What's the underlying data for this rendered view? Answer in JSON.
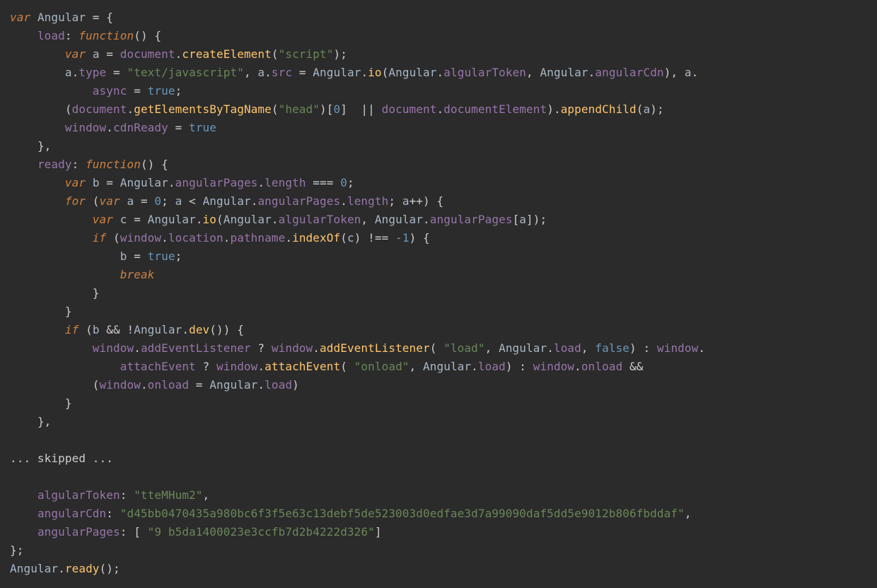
{
  "code": {
    "line1": {
      "kw_var": "var",
      "Angular": "Angular",
      "eq": " = {"
    },
    "line2": {
      "prop_load": "load",
      "colon": ": ",
      "kw_fn": "function",
      "paren": "() {"
    },
    "line3": {
      "kw_var": "var",
      "a": "a",
      "eq": " = ",
      "doc": "document",
      "dot": ".",
      "call": "createElement",
      "arg": "\"script\"",
      "end": ");"
    },
    "line4": {
      "a1": "a",
      "dot1": ".",
      "type": "type",
      "eq1": " = ",
      "str1": "\"text/javascript\"",
      "comma": ", ",
      "a2": "a",
      "dot2": ".",
      "src": "src",
      "eq2": " = ",
      "Ang": "Angular",
      "dot3": ".",
      "io": "io",
      "lp": "(",
      "Ang2": "Angular",
      "dot4": ".",
      "tok": "algularToken",
      "comma2": ", ",
      "Ang3": "Angular",
      "dot5": ".",
      "cdn": "angularCdn",
      "rp": "), ",
      "a3": "a",
      "dot6": "."
    },
    "line5": {
      "async": "async",
      "eq": " = ",
      "true": "true",
      "semi": ";"
    },
    "line6": {
      "lp": "(",
      "doc": "document",
      "dot": ".",
      "get": "getElementsByTagName",
      "arg": "\"head\"",
      "idx": ")[",
      "zero": "0",
      "rb": "] ",
      "or": " || ",
      "doc2": "document",
      "dot2": ".",
      "docel": "documentElement",
      "rp": ").",
      "append": "appendChild",
      "lp2": "(",
      "a": "a",
      "end": ");"
    },
    "line7": {
      "win": "window",
      "dot": ".",
      "cdn": "cdnReady",
      "eq": " = ",
      "true": "true"
    },
    "line8": {
      "brace": "},"
    },
    "line9": {
      "prop_ready": "ready",
      "colon": ": ",
      "kw_fn": "function",
      "paren": "() {"
    },
    "line10": {
      "kw_var": "var",
      "b": "b",
      "eq": " = ",
      "Ang": "Angular",
      "dot": ".",
      "pages": "angularPages",
      "dot2": ".",
      "len": "length",
      "eqeq": " === ",
      "zero": "0",
      "semi": ";"
    },
    "line11": {
      "kw_for": "for",
      "lp": " (",
      "kw_var": "var",
      "a": "a",
      "eq": " = ",
      "zero": "0",
      "semi": "; ",
      "a2": "a",
      "lt": " < ",
      "Ang": "Angular",
      "dot": ".",
      "pages": "angularPages",
      "dot2": ".",
      "len": "length",
      "semi2": "; ",
      "a3": "a",
      "pp": "++) {"
    },
    "line12": {
      "kw_var": "var",
      "c": "c",
      "eq": " = ",
      "Ang": "Angular",
      "dot": ".",
      "io": "io",
      "lp": "(",
      "Ang2": "Angular",
      "dot2": ".",
      "tok": "algularToken",
      "comma": ", ",
      "Ang3": "Angular",
      "dot3": ".",
      "pages": "angularPages",
      "lb": "[",
      "a": "a",
      "rb": "]);"
    },
    "line13": {
      "kw_if": "if",
      "lp": " (",
      "win": "window",
      "dot": ".",
      "loc": "location",
      "dot2": ".",
      "path": "pathname",
      "dot3": ".",
      "idx": "indexOf",
      "lp2": "(",
      "c": "c",
      "rp": ") ",
      "neq": "!== ",
      "neg1": "-1",
      "rp2": ") {"
    },
    "line14": {
      "b": "b",
      "eq": " = ",
      "true": "true",
      "semi": ";"
    },
    "line15": {
      "break": "break"
    },
    "line16": {
      "brace": "}"
    },
    "line17": {
      "brace": "}"
    },
    "line18": {
      "kw_if": "if",
      "lp": " (",
      "b": "b",
      "and": " && ",
      "not": "!",
      "Ang": "Angular",
      "dot": ".",
      "dev": "dev",
      "paren": "()) {"
    },
    "line19": {
      "win": "window",
      "dot": ".",
      "ael": "addEventListener",
      "q": " ? ",
      "win2": "window",
      "dot2": ".",
      "ael2": "addEventListener",
      "lp": "( ",
      "str": "\"load\"",
      "comma": ", ",
      "Ang": "Angular",
      "dot3": ".",
      "load": "load",
      "comma2": ", ",
      "false": "false",
      "rp": ") : ",
      "win3": "window",
      "dot4": "."
    },
    "line20": {
      "att": "attachEvent",
      "q": " ? ",
      "win": "window",
      "dot": ".",
      "att2": "attachEvent",
      "lp": "( ",
      "str": "\"onload\"",
      "comma": ", ",
      "Ang": "Angular",
      "dot2": ".",
      "load": "load",
      "rp": ") : ",
      "win2": "window",
      "dot3": ".",
      "onload": "onload",
      "and": " &&"
    },
    "line21": {
      "lp": "(",
      "win": "window",
      "dot": ".",
      "onload": "onload",
      "eq": " = ",
      "Ang": "Angular",
      "dot2": ".",
      "load": "load",
      "rp": ")"
    },
    "line22": {
      "brace": "}"
    },
    "line23": {
      "brace": "},"
    },
    "skipped": "... skipped ...",
    "line25": {
      "tok": "algularToken",
      "colon": ": ",
      "val": "\"tteMHum2\"",
      "comma": ","
    },
    "line26": {
      "cdn": "angularCdn",
      "colon": ": ",
      "val": "\"d45bb0470435a980bc6f3f5e63c13debf5de523003d0edfae3d7a99090daf5dd5e9012b806fbddaf\"",
      "comma": ","
    },
    "line27": {
      "pages": "angularPages",
      "colon": ": [ ",
      "val": "\"9 b5da1400023e3ccfb7d2b4222d326\"",
      "rb": "]"
    },
    "line28": {
      "brace": "};"
    },
    "line29": {
      "Ang": "Angular",
      "dot": ".",
      "ready": "ready",
      "paren": "();"
    }
  }
}
